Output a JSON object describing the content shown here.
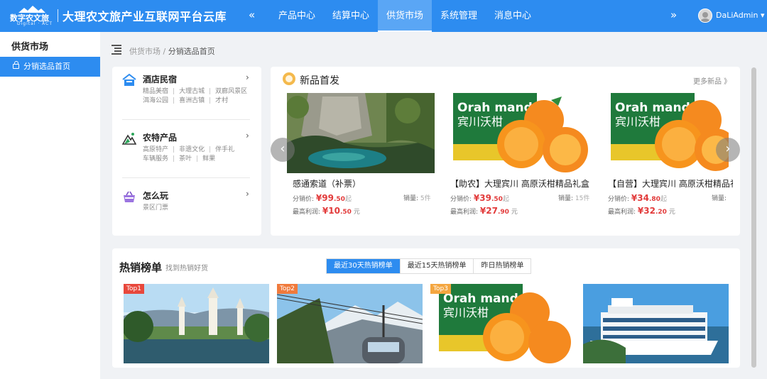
{
  "header": {
    "logo_text": "数字农文旅",
    "logo_sub": "Digital · ACT",
    "app_title": "大理农文旅产业互联网平台云库",
    "nav": [
      {
        "label": "产品中心",
        "active": false
      },
      {
        "label": "结算中心",
        "active": false
      },
      {
        "label": "供货市场",
        "active": true
      },
      {
        "label": "系统管理",
        "active": false
      },
      {
        "label": "消息中心",
        "active": false
      }
    ],
    "collapse_left": "«",
    "collapse_right": "»",
    "user": "DaLiAdmin",
    "user_caret": "▾"
  },
  "sidebar": {
    "title": "供货市场",
    "items": [
      {
        "label": "分销选品首页",
        "active": true
      }
    ]
  },
  "breadcrumb": {
    "root": "供货市场",
    "sep": "/",
    "current": "分销选品首页"
  },
  "categories": [
    {
      "name": "酒店民宿",
      "tags_row1": [
        "精品美宿",
        "大理古城",
        "双廊风景区"
      ],
      "tags_row2": [
        "洱海公园",
        "喜洲古镇",
        "才村"
      ],
      "icon": "hotel-icon"
    },
    {
      "name": "农特产品",
      "tags_row1": [
        "高原特产",
        "非遗文化",
        "伴手礼"
      ],
      "tags_row2": [
        "车辆服务",
        "茶叶",
        "鲜果"
      ],
      "icon": "mountain-icon"
    },
    {
      "name": "怎么玩",
      "tags_row1": [
        "景区门票"
      ],
      "tags_row2": [],
      "icon": "basket-icon"
    }
  ],
  "new_products": {
    "title": "新品首发",
    "more": "更多新品 》",
    "price_label": "分销价:",
    "profit_label": "最高利润:",
    "sales_label": "销量:",
    "items": [
      {
        "name": "感通索道（补票）",
        "price_int": "¥99",
        "price_dec": ".50",
        "price_suffix": "起",
        "profit_int": "¥10",
        "profit_dec": ".50",
        "profit_suffix": "元",
        "sales": "5件"
      },
      {
        "name": "【助农】大理宾川 高原沃柑精品礼盒",
        "price_int": "¥39",
        "price_dec": ".50",
        "price_suffix": "起",
        "profit_int": "¥27",
        "profit_dec": ".90",
        "profit_suffix": "元",
        "sales": "15件"
      },
      {
        "name": "【自营】大理宾川 高原沃柑精品礼盒",
        "price_int": "¥34",
        "price_dec": ".80",
        "price_suffix": "起",
        "profit_int": "¥32",
        "profit_dec": ".20",
        "profit_suffix": "元",
        "sales": ""
      }
    ],
    "box_brand": "Orah mandarin",
    "box_cn": "宾川沃柑"
  },
  "hot": {
    "title": "热销榜单",
    "subtitle": "找到热销好货",
    "tabs": [
      {
        "label": "最近30天热销榜单",
        "active": true
      },
      {
        "label": "最近15天热销榜单",
        "active": false
      },
      {
        "label": "昨日热销榜单",
        "active": false
      }
    ],
    "ranks": [
      "Top1",
      "Top2",
      "Top3"
    ]
  },
  "colors": {
    "primary": "#2d8cf0",
    "price_red": "#e23b3b",
    "top1": "#e8483c",
    "top2": "#f07a3c",
    "top3": "#f4a640"
  }
}
